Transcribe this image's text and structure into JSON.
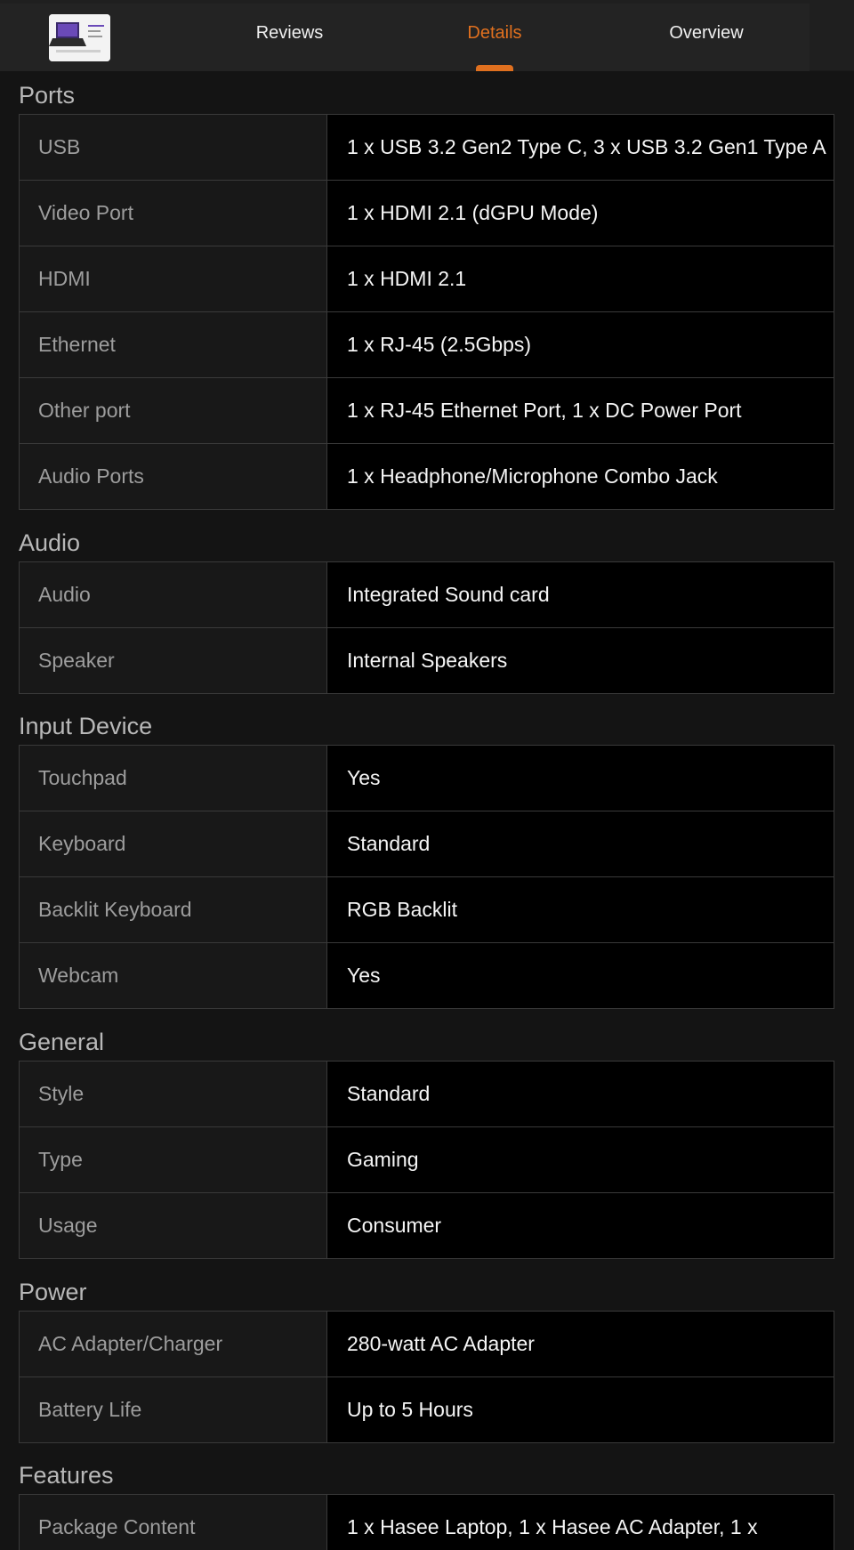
{
  "nav": {
    "tabs": [
      {
        "label": "Reviews"
      },
      {
        "label": "Details"
      },
      {
        "label": "Overview"
      }
    ],
    "active_tab": "Details",
    "accent_color": "#e0701f"
  },
  "sections": [
    {
      "title": "Ports",
      "rows": [
        {
          "label": "USB",
          "value": "1 x USB 3.2 Gen2 Type C, 3 x USB 3.2 Gen1 Type A"
        },
        {
          "label": "Video Port",
          "value": "1 x HDMI 2.1 (dGPU Mode)"
        },
        {
          "label": "HDMI",
          "value": "1 x HDMI 2.1"
        },
        {
          "label": "Ethernet",
          "value": "1 x RJ-45 (2.5Gbps)"
        },
        {
          "label": "Other port",
          "value": "1 x RJ-45 Ethernet Port, 1 x DC Power Port"
        },
        {
          "label": "Audio Ports",
          "value": "1 x Headphone/Microphone Combo Jack"
        }
      ]
    },
    {
      "title": "Audio",
      "rows": [
        {
          "label": "Audio",
          "value": "Integrated Sound card"
        },
        {
          "label": "Speaker",
          "value": "Internal Speakers"
        }
      ]
    },
    {
      "title": "Input Device",
      "rows": [
        {
          "label": "Touchpad",
          "value": "Yes"
        },
        {
          "label": "Keyboard",
          "value": "Standard"
        },
        {
          "label": "Backlit Keyboard",
          "value": "RGB Backlit"
        },
        {
          "label": "Webcam",
          "value": "Yes"
        }
      ]
    },
    {
      "title": "General",
      "rows": [
        {
          "label": "Style",
          "value": "Standard"
        },
        {
          "label": "Type",
          "value": "Gaming"
        },
        {
          "label": "Usage",
          "value": "Consumer"
        }
      ]
    },
    {
      "title": "Power",
      "rows": [
        {
          "label": "AC Adapter/Charger",
          "value": "280-watt AC Adapter"
        },
        {
          "label": "Battery Life",
          "value": "Up to 5 Hours"
        }
      ]
    },
    {
      "title": "Features",
      "rows": [
        {
          "label": "Package Content",
          "value": "1 x Hasee Laptop, 1 x Hasee AC Adapter, 1 x"
        }
      ]
    }
  ]
}
